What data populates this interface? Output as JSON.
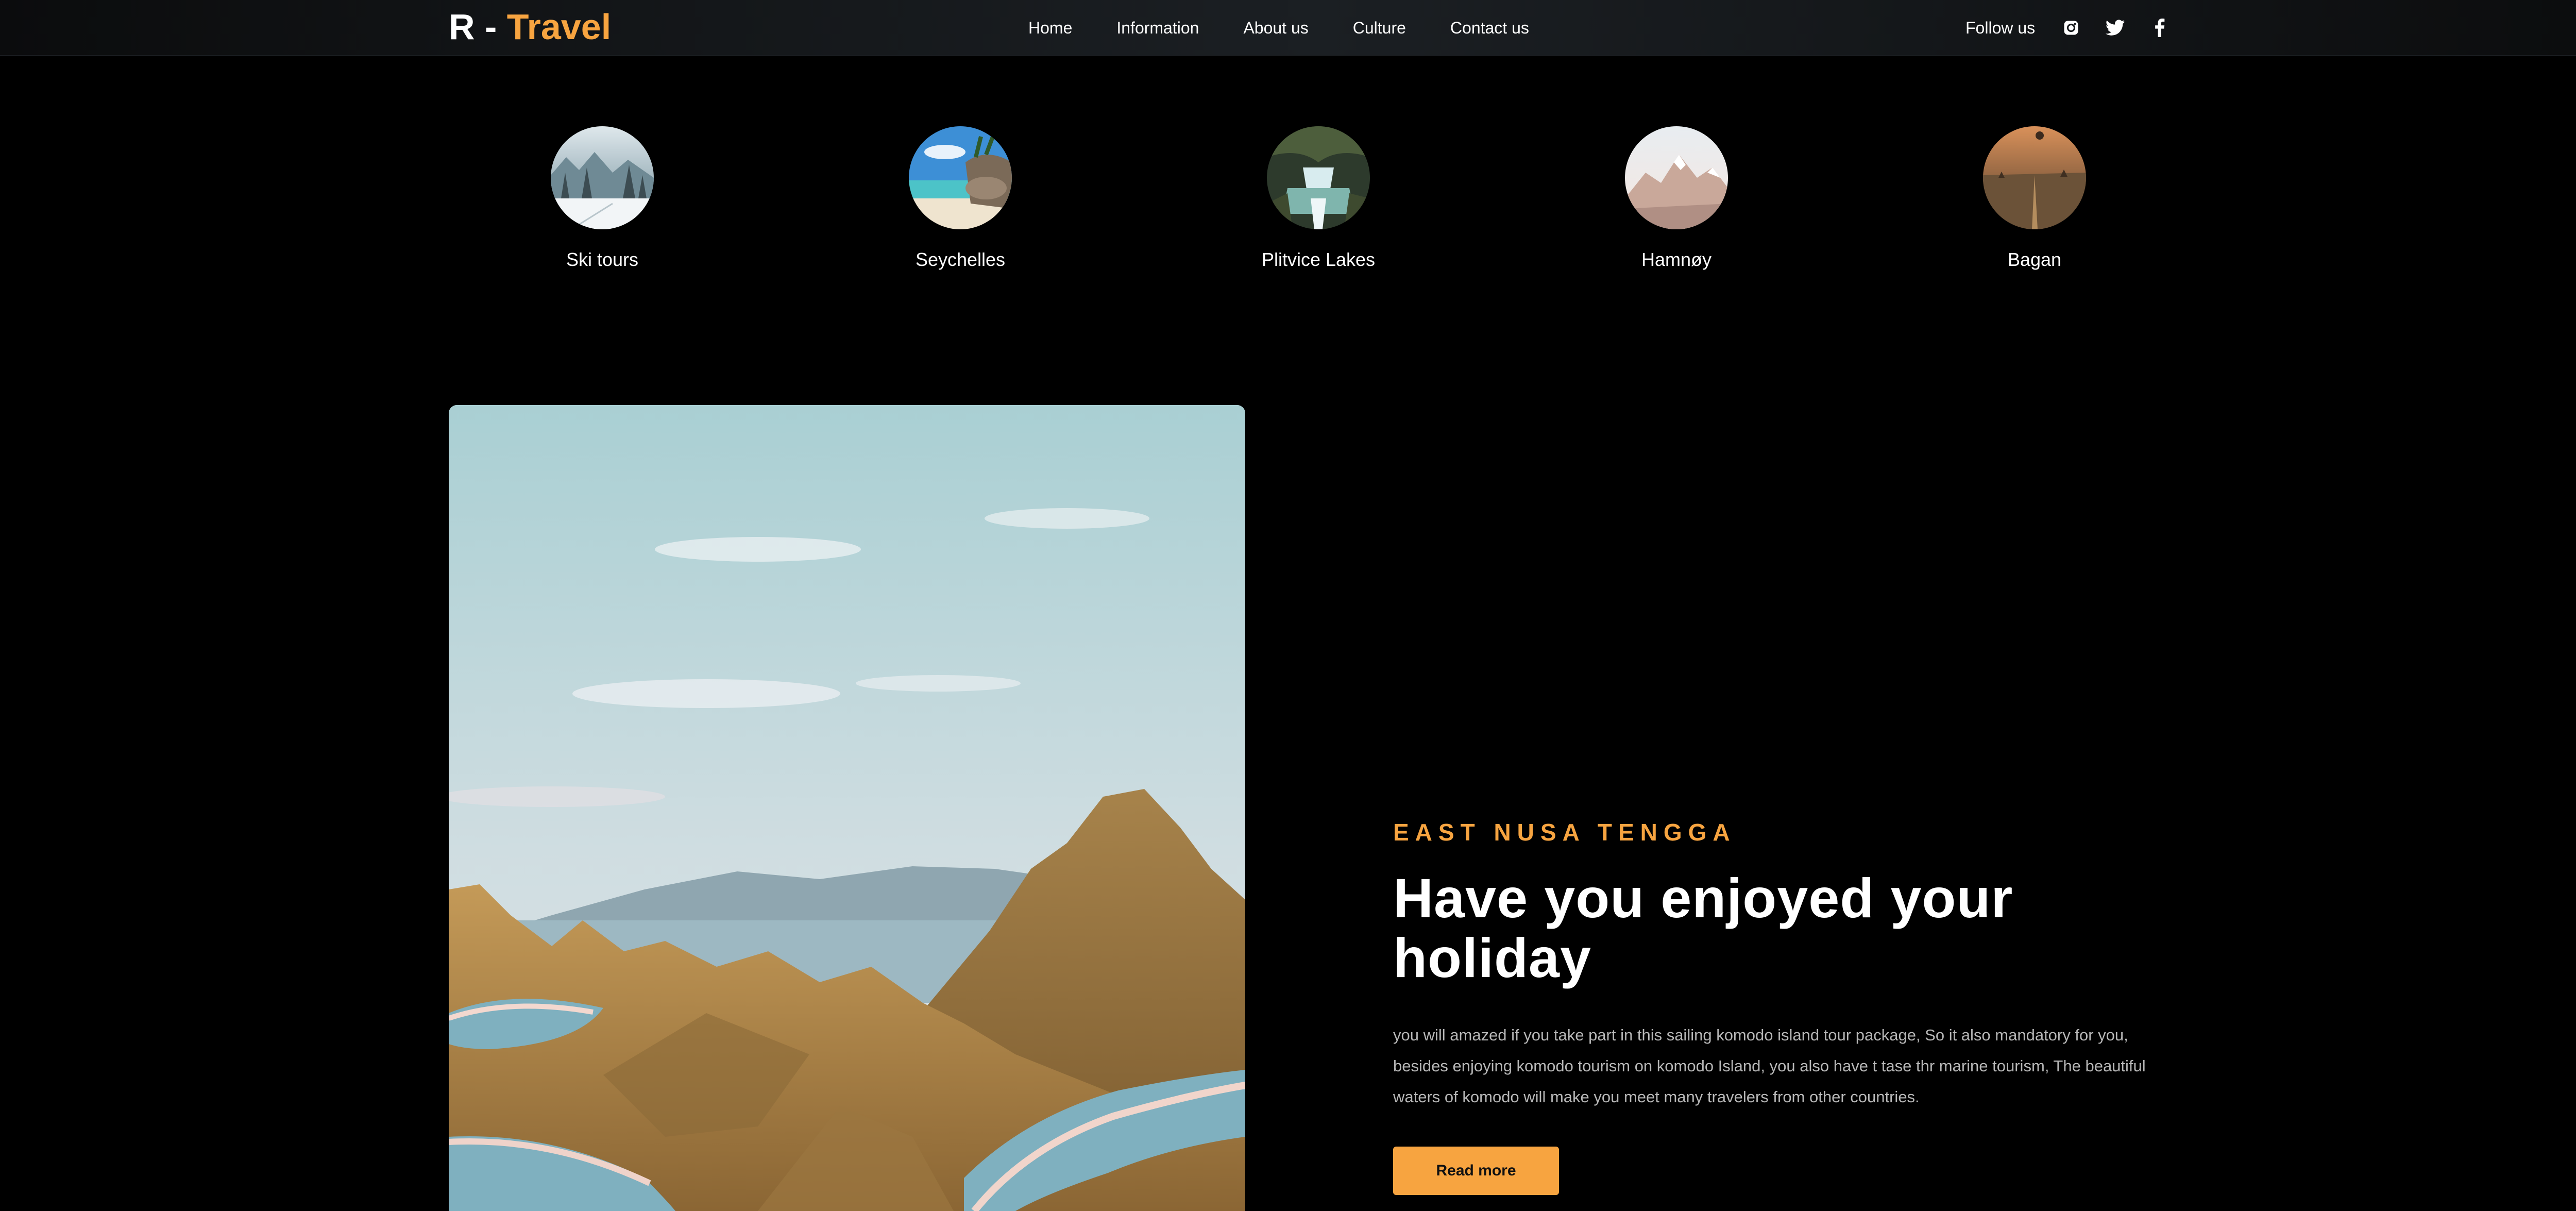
{
  "navbar": {
    "logo_prefix": "R - ",
    "logo_accent": "Travel",
    "links": [
      "Home",
      "Information",
      "About us",
      "Culture",
      "Contact us"
    ],
    "follow_label": "Follow us",
    "social_icons": [
      "instagram-icon",
      "twitter-icon",
      "facebook-icon"
    ]
  },
  "destinations": [
    {
      "label": "Ski tours"
    },
    {
      "label": "Seychelles"
    },
    {
      "label": "Plitvice Lakes"
    },
    {
      "label": "Hamnøy"
    },
    {
      "label": "Bagan"
    }
  ],
  "hero": {
    "eyebrow": "EAST NUSA TENGGA",
    "headline": "Have you enjoyed your holiday",
    "body": "you will amazed if you take part in this sailing komodo island tour package, So it also mandatory for you, besides enjoying komodo tourism on komodo Island, you also have t tase thr marine tourism, The beautiful waters of komodo will make you meet many travelers from other countries.",
    "button_label": "Read more"
  },
  "colors": {
    "accent": "#f7a440",
    "background": "#000000",
    "body_text": "#b8b8b8"
  }
}
